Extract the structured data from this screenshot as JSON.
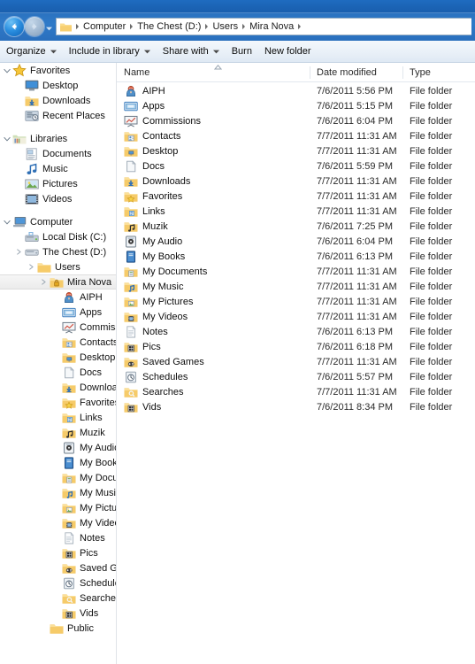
{
  "titlebar": {
    "name": "explorer-title-bar"
  },
  "navigation": {
    "back_label": "Back",
    "forward_label": "Forward",
    "recent_pages_label": "Recent pages"
  },
  "address": {
    "crumbs": [
      "Computer",
      "The Chest (D:)",
      "Users",
      "Mira Nova"
    ]
  },
  "toolbar": {
    "items": [
      {
        "label": "Organize",
        "caret": true
      },
      {
        "label": "Include in library",
        "caret": true
      },
      {
        "label": "Share with",
        "caret": true
      },
      {
        "label": "Burn",
        "caret": false
      },
      {
        "label": "New folder",
        "caret": false
      }
    ]
  },
  "sidebar": {
    "groups": [
      {
        "header": {
          "label": "Favorites",
          "icon": "star-icon",
          "indent": 14
        },
        "items": [
          {
            "label": "Desktop",
            "icon": "desktop-icon",
            "indent": 28
          },
          {
            "label": "Downloads",
            "icon": "downloads-folder-icon",
            "indent": 28
          },
          {
            "label": "Recent Places",
            "icon": "recent-places-icon",
            "indent": 28
          }
        ]
      },
      {
        "header": {
          "label": "Libraries",
          "icon": "libraries-icon",
          "indent": 14
        },
        "items": [
          {
            "label": "Documents",
            "icon": "documents-library-icon",
            "indent": 28
          },
          {
            "label": "Music",
            "icon": "music-library-icon",
            "indent": 28
          },
          {
            "label": "Pictures",
            "icon": "pictures-library-icon",
            "indent": 28
          },
          {
            "label": "Videos",
            "icon": "videos-library-icon",
            "indent": 28
          }
        ]
      },
      {
        "header": {
          "label": "Computer",
          "icon": "computer-icon",
          "indent": 14
        },
        "items": [
          {
            "label": "Local Disk (C:)",
            "icon": "system-drive-icon",
            "indent": 28
          },
          {
            "label": "The Chest (D:)",
            "icon": "hard-drive-icon",
            "indent": 28,
            "chevron": true
          },
          {
            "label": "Users",
            "icon": "folder-icon",
            "indent": 42,
            "chevron": true
          },
          {
            "label": "Mira Nova",
            "icon": "locked-folder-icon",
            "indent": 56,
            "chevron": true,
            "selected": true
          },
          {
            "label": "AIPH",
            "icon": "aiph-folder-icon",
            "indent": 70
          },
          {
            "label": "Apps",
            "icon": "apps-folder-icon",
            "indent": 70
          },
          {
            "label": "Commissions",
            "icon": "commissions-folder-icon",
            "indent": 70
          },
          {
            "label": "Contacts",
            "icon": "contacts-folder-icon",
            "indent": 70
          },
          {
            "label": "Desktop",
            "icon": "desktop-folder-icon",
            "indent": 70
          },
          {
            "label": "Docs",
            "icon": "docs-folder-icon",
            "indent": 70
          },
          {
            "label": "Downloads",
            "icon": "downloads-folder-icon",
            "indent": 70
          },
          {
            "label": "Favorites",
            "icon": "favorites-folder-icon",
            "indent": 70
          },
          {
            "label": "Links",
            "icon": "links-folder-icon",
            "indent": 70
          },
          {
            "label": "Muzik",
            "icon": "muzik-folder-icon",
            "indent": 70
          },
          {
            "label": "My Audio",
            "icon": "my-audio-folder-icon",
            "indent": 70
          },
          {
            "label": "My Books",
            "icon": "my-books-folder-icon",
            "indent": 70
          },
          {
            "label": "My Document",
            "icon": "my-documents-folder-icon",
            "indent": 70
          },
          {
            "label": "My Music",
            "icon": "my-music-folder-icon",
            "indent": 70
          },
          {
            "label": "My Pictures",
            "icon": "my-pictures-folder-icon",
            "indent": 70
          },
          {
            "label": "My Videos",
            "icon": "my-videos-folder-icon",
            "indent": 70
          },
          {
            "label": "Notes",
            "icon": "notes-folder-icon",
            "indent": 70
          },
          {
            "label": "Pics",
            "icon": "pics-folder-icon",
            "indent": 70
          },
          {
            "label": "Saved Games",
            "icon": "saved-games-folder-icon",
            "indent": 70
          },
          {
            "label": "Schedules",
            "icon": "schedules-folder-icon",
            "indent": 70
          },
          {
            "label": "Searches",
            "icon": "searches-folder-icon",
            "indent": 70
          },
          {
            "label": "Vids",
            "icon": "vids-folder-icon",
            "indent": 70
          },
          {
            "label": "Public",
            "icon": "folder-icon",
            "indent": 56
          }
        ]
      }
    ]
  },
  "filelist": {
    "columns": [
      {
        "label": "Name",
        "key": "name"
      },
      {
        "label": "Date modified",
        "key": "date"
      },
      {
        "label": "Type",
        "key": "type"
      }
    ],
    "sort": {
      "column": "Name",
      "direction": "ascending"
    },
    "rows": [
      {
        "name": "AIPH",
        "date": "7/6/2011 5:56 PM",
        "type": "File folder",
        "icon": "aiph-folder-icon"
      },
      {
        "name": "Apps",
        "date": "7/6/2011 5:15 PM",
        "type": "File folder",
        "icon": "apps-folder-icon"
      },
      {
        "name": "Commissions",
        "date": "7/6/2011 6:04 PM",
        "type": "File folder",
        "icon": "commissions-folder-icon"
      },
      {
        "name": "Contacts",
        "date": "7/7/2011 11:31 AM",
        "type": "File folder",
        "icon": "contacts-folder-icon"
      },
      {
        "name": "Desktop",
        "date": "7/7/2011 11:31 AM",
        "type": "File folder",
        "icon": "desktop-folder-icon"
      },
      {
        "name": "Docs",
        "date": "7/6/2011 5:59 PM",
        "type": "File folder",
        "icon": "docs-folder-icon"
      },
      {
        "name": "Downloads",
        "date": "7/7/2011 11:31 AM",
        "type": "File folder",
        "icon": "downloads-folder-icon"
      },
      {
        "name": "Favorites",
        "date": "7/7/2011 11:31 AM",
        "type": "File folder",
        "icon": "favorites-folder-icon"
      },
      {
        "name": "Links",
        "date": "7/7/2011 11:31 AM",
        "type": "File folder",
        "icon": "links-folder-icon"
      },
      {
        "name": "Muzik",
        "date": "7/6/2011 7:25 PM",
        "type": "File folder",
        "icon": "muzik-folder-icon"
      },
      {
        "name": "My Audio",
        "date": "7/6/2011 6:04 PM",
        "type": "File folder",
        "icon": "my-audio-folder-icon"
      },
      {
        "name": "My Books",
        "date": "7/6/2011 6:13 PM",
        "type": "File folder",
        "icon": "my-books-folder-icon"
      },
      {
        "name": "My Documents",
        "date": "7/7/2011 11:31 AM",
        "type": "File folder",
        "icon": "my-documents-folder-icon"
      },
      {
        "name": "My Music",
        "date": "7/7/2011 11:31 AM",
        "type": "File folder",
        "icon": "my-music-folder-icon"
      },
      {
        "name": "My Pictures",
        "date": "7/7/2011 11:31 AM",
        "type": "File folder",
        "icon": "my-pictures-folder-icon"
      },
      {
        "name": "My Videos",
        "date": "7/7/2011 11:31 AM",
        "type": "File folder",
        "icon": "my-videos-folder-icon"
      },
      {
        "name": "Notes",
        "date": "7/6/2011 6:13 PM",
        "type": "File folder",
        "icon": "notes-folder-icon"
      },
      {
        "name": "Pics",
        "date": "7/6/2011 6:18 PM",
        "type": "File folder",
        "icon": "pics-folder-icon"
      },
      {
        "name": "Saved Games",
        "date": "7/7/2011 11:31 AM",
        "type": "File folder",
        "icon": "saved-games-folder-icon"
      },
      {
        "name": "Schedules",
        "date": "7/6/2011 5:57 PM",
        "type": "File folder",
        "icon": "schedules-folder-icon"
      },
      {
        "name": "Searches",
        "date": "7/7/2011 11:31 AM",
        "type": "File folder",
        "icon": "searches-folder-icon"
      },
      {
        "name": "Vids",
        "date": "7/6/2011 8:34 PM",
        "type": "File folder",
        "icon": "vids-folder-icon"
      }
    ]
  },
  "colors": {
    "titlebar_blue": "#1b63b4",
    "address_blue": "#2f7ac8",
    "toolbar_top": "#f4f8fc",
    "folder_yellow": "#fcc straight",
    "selection_gray": "#ebebeb"
  }
}
